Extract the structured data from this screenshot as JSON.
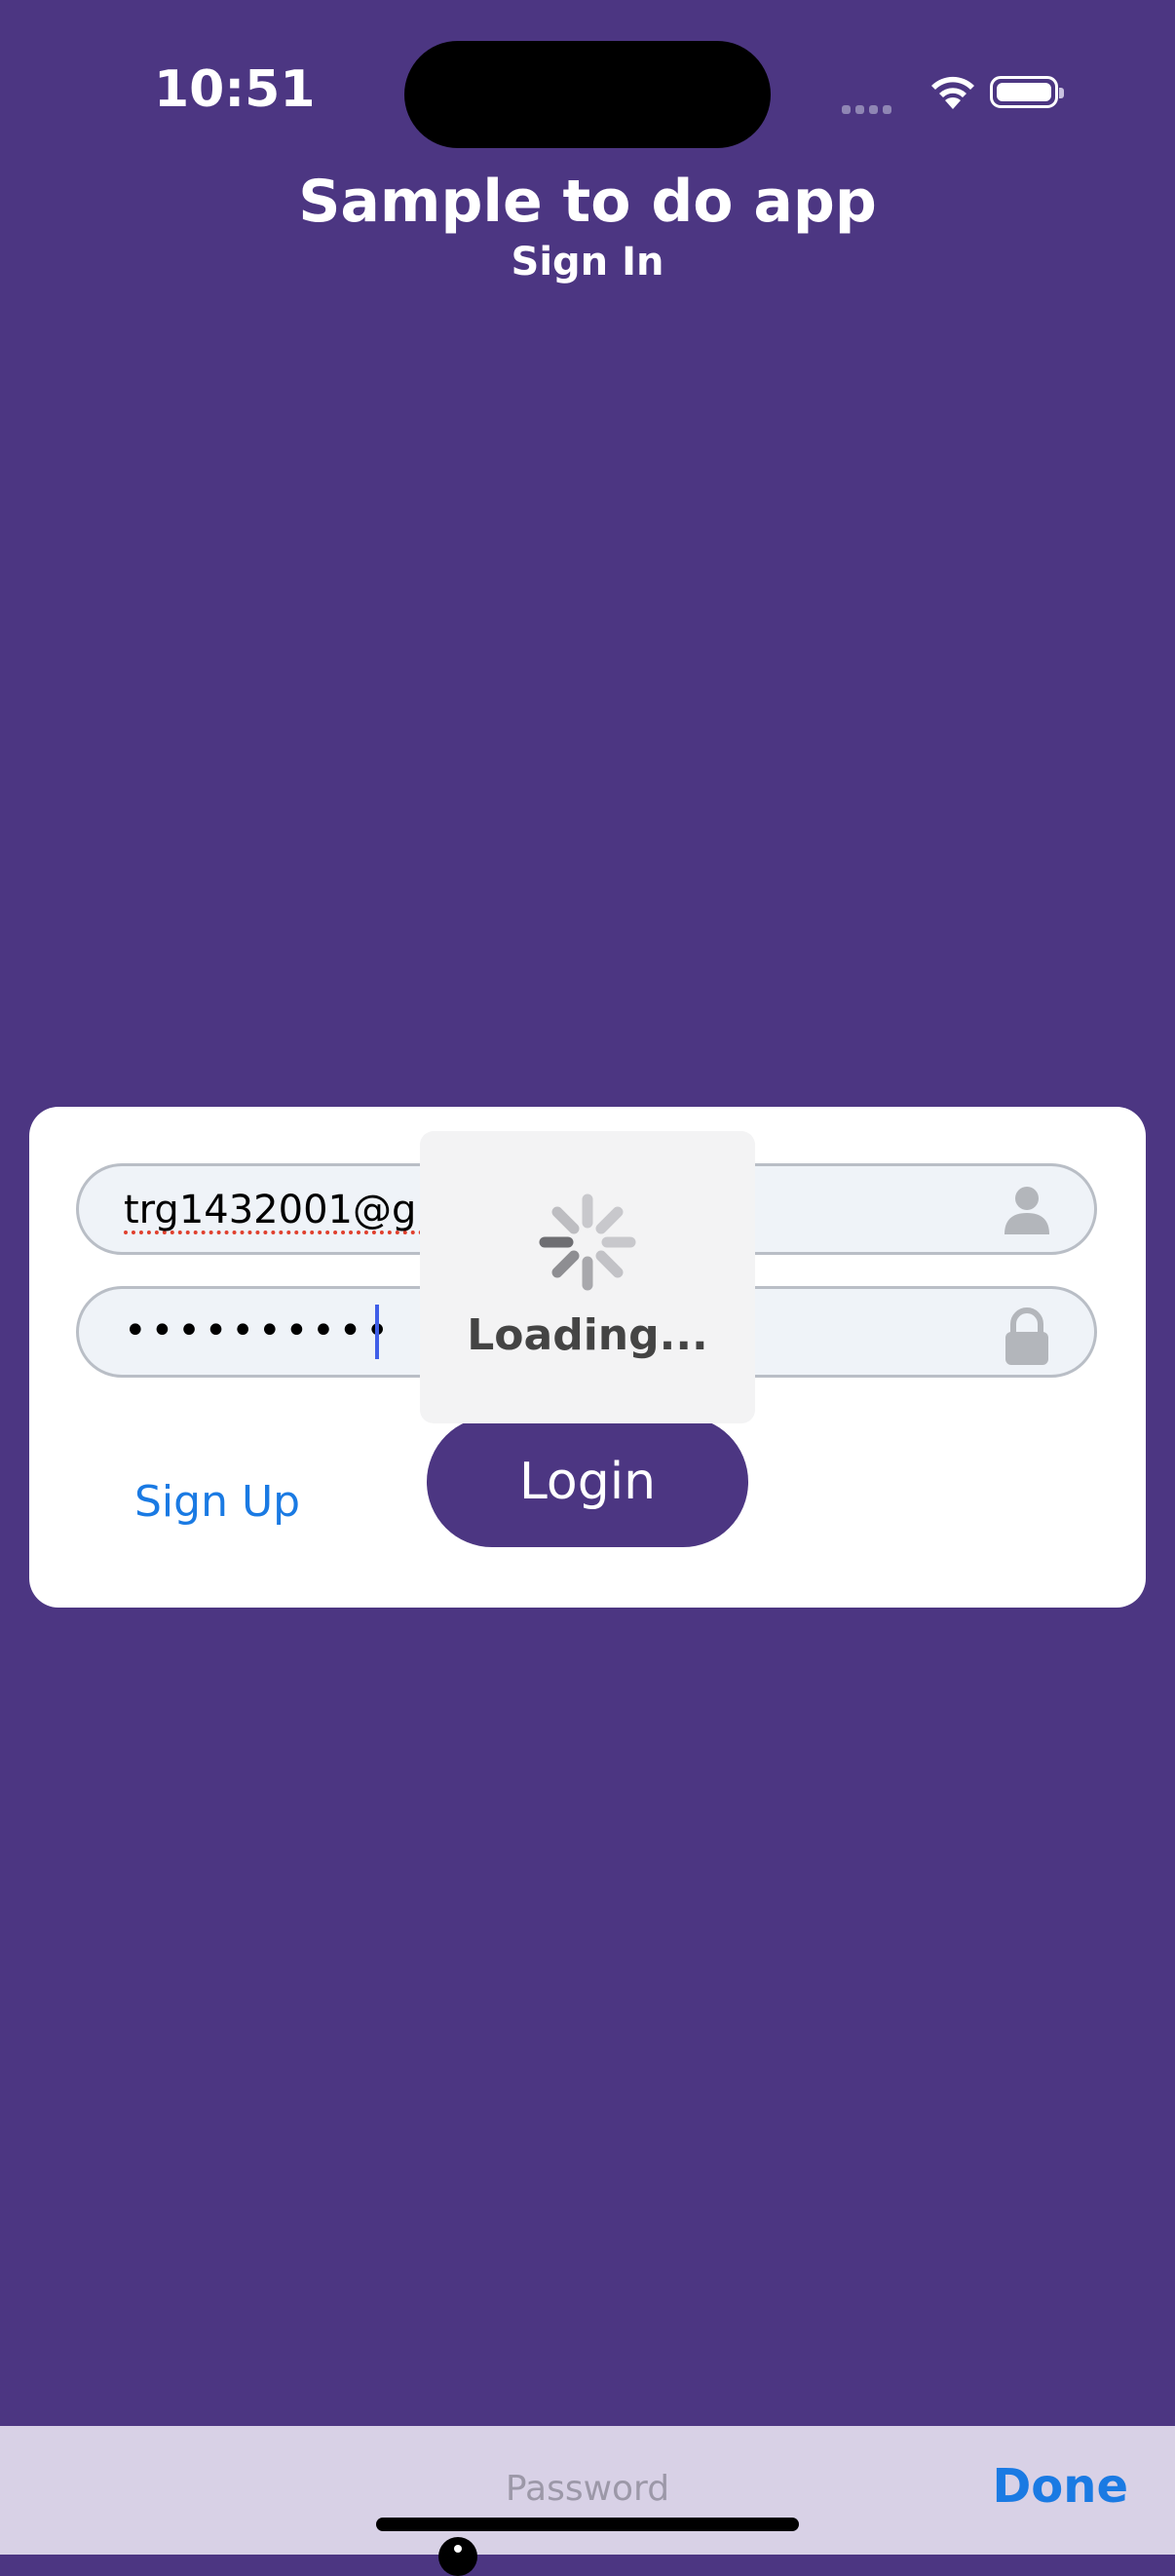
{
  "status_bar": {
    "time": "10:51"
  },
  "header": {
    "title": "Sample to do app",
    "subtitle": "Sign In"
  },
  "login_form": {
    "email_value": "trg1432001@gm",
    "password_dots": "••••••••••",
    "signup_label": "Sign Up",
    "login_label": "Login"
  },
  "loading_overlay": {
    "text": "Loading..."
  },
  "keyboard_toolbar": {
    "field_label": "Password",
    "done_label": "Done"
  },
  "colors": {
    "background": "#4c3682",
    "accent": "#1a7ae3",
    "card": "#ffffff"
  }
}
